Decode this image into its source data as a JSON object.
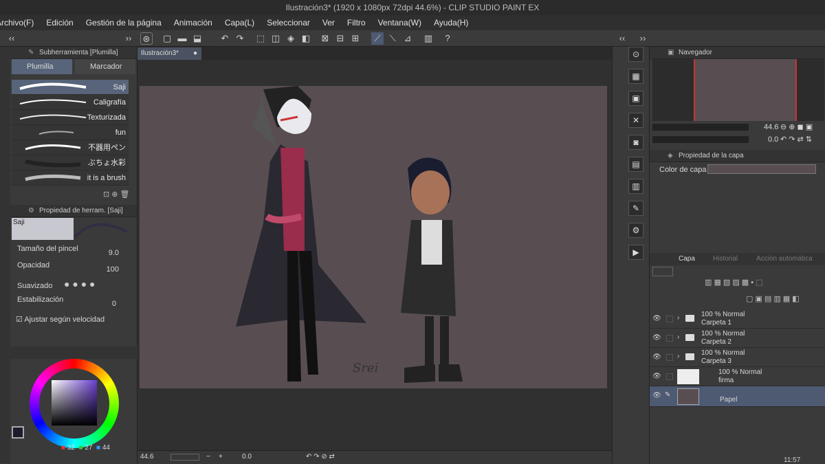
{
  "window": {
    "title": "Ilustración3* (1920 x 1080px 72dpi 44.6%) - CLIP STUDIO PAINT EX"
  },
  "menu": [
    "Archivo(F)",
    "Edición",
    "Gestión de la página",
    "Animación",
    "Capa(L)",
    "Seleccionar",
    "Ver",
    "Filtro",
    "Ventana(W)",
    "Ayuda(H)"
  ],
  "document": {
    "tab": "Ilustración3*",
    "signature": "Srei"
  },
  "subtool": {
    "title": "Subherramienta [Plumilla]",
    "tabs": [
      "Plumilla",
      "Marcador"
    ],
    "brushes": [
      "Saji",
      "Caligrafía",
      "Texturizada",
      "fun",
      "不器用ペン",
      "ぶちょ水彩",
      "it is a brush"
    ]
  },
  "toolprop": {
    "title": "Propiedad de herram. [Saji]",
    "brush": "Saji",
    "size_label": "Tamaño del pincel",
    "size": "9.0",
    "opacity_label": "Opacidad",
    "opacity": "100",
    "smooth_label": "Suavizado",
    "stab_label": "Estabilización",
    "stab": "0",
    "speed_label": "Ajustar según velocidad"
  },
  "color": {
    "r": "32",
    "g": "27",
    "b": "44",
    "main": "#201b2c",
    "accent": "#4d5a72"
  },
  "navigator": {
    "title": "Navegador",
    "zoom": "44.6",
    "angle": "0.0"
  },
  "layerprop": {
    "title": "Propiedad de la capa",
    "color_label": "Color de capa"
  },
  "layers_panel": {
    "tabs": [
      "Capa",
      "Historial",
      "Acción automática"
    ]
  },
  "layers": [
    {
      "mode": "100 % Normal",
      "name": "Carpeta 1"
    },
    {
      "mode": "100 % Normal",
      "name": "Carpeta 2"
    },
    {
      "mode": "100 % Normal",
      "name": "Carpeta 3"
    },
    {
      "mode": "100 % Normal",
      "name": "firma"
    },
    {
      "mode": "",
      "name": "Papel"
    }
  ],
  "status": {
    "zoom": "44.6",
    "angle": "0.0"
  },
  "clock": "11:57"
}
